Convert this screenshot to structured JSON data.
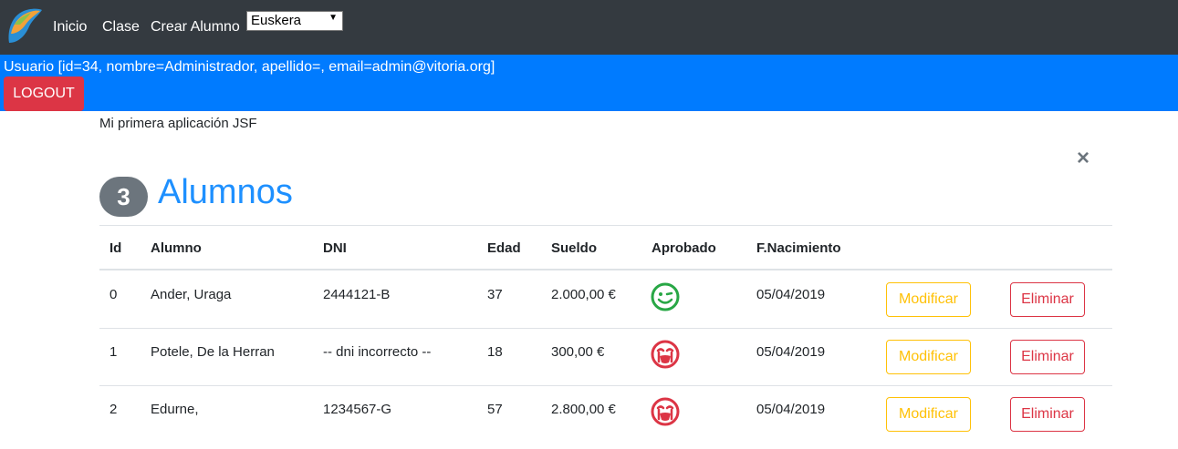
{
  "nav": {
    "links": [
      "Inicio",
      "Clase",
      "Crear Alumno"
    ],
    "language_selected": "Euskera"
  },
  "user": {
    "info": "Usuario [id=34, nombre=Administrador, apellido=, email=admin@vitoria.org]",
    "logout_label": "LOGOUT"
  },
  "subtitle": "Mi primera aplicación JSF",
  "close_label": "×",
  "heading": {
    "count": "3",
    "title": "Alumnos"
  },
  "table": {
    "headers": [
      "Id",
      "Alumno",
      "DNI",
      "Edad",
      "Sueldo",
      "Aprobado",
      "F.Nacimiento"
    ],
    "rows": [
      {
        "id": "0",
        "alumno": "Ander, Uraga",
        "dni": "2444121-B",
        "edad": "37",
        "sueldo": "2.000,00 €",
        "aprobado_icon": "happy-face-icon",
        "fecha": "05/04/2019",
        "modify_label": "Modificar",
        "delete_label": "Eliminar"
      },
      {
        "id": "1",
        "alumno": "Potele, De la Herran",
        "dni": "-- dni incorrecto --",
        "edad": "18",
        "sueldo": "300,00 €",
        "aprobado_icon": "crying-face-icon",
        "fecha": "05/04/2019",
        "modify_label": "Modificar",
        "delete_label": "Eliminar"
      },
      {
        "id": "2",
        "alumno": "Edurne,",
        "dni": "1234567-G",
        "edad": "57",
        "sueldo": "2.800,00 €",
        "aprobado_icon": "crying-face-icon",
        "fecha": "05/04/2019",
        "modify_label": "Modificar",
        "delete_label": "Eliminar"
      }
    ]
  },
  "colors": {
    "navbar": "#343a40",
    "userbar": "#007bff",
    "logout": "#dc3545",
    "warning": "#ffc107",
    "danger": "#dc3545",
    "success": "#28a745",
    "title": "#1e90ff",
    "badge": "#6c757d"
  }
}
